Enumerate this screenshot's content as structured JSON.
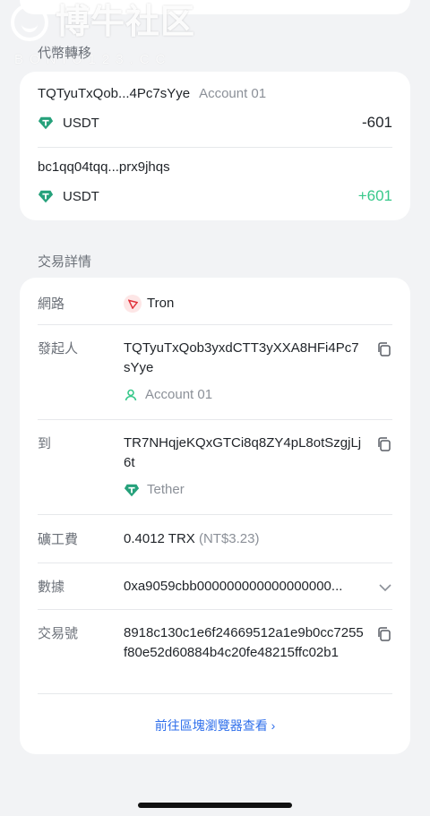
{
  "watermark": {
    "logo_text": "博牛社区",
    "sub_text": "BONIU123.CC"
  },
  "transfer_section": {
    "title": "代幣轉移"
  },
  "transfer": {
    "from_address": "TQTyuTxQob...4Pc7sYye",
    "from_account": "Account 01",
    "from_token": "USDT",
    "from_amount": "-601",
    "to_address": "bc1qq04tqq...prx9jhqs",
    "to_token": "USDT",
    "to_amount": "+601"
  },
  "details_section": {
    "title": "交易詳情"
  },
  "details": {
    "network": {
      "label": "網路",
      "value": "Tron"
    },
    "sender": {
      "label": "發起人",
      "address": "TQTyuTxQob3yxdCTT3yXXA8HFi4Pc7sYye",
      "account": "Account 01"
    },
    "to": {
      "label": "到",
      "address": "TR7NHqjeKQxGTCi8q8ZY4pL8otSzgjLj6t",
      "name": "Tether"
    },
    "fee": {
      "label": "礦工費",
      "value": "0.4012 TRX",
      "fiat": "(NT$3.23)"
    },
    "data": {
      "label": "數據",
      "value": "0xa9059cbb000000000000000000..."
    },
    "tx_hash": {
      "label": "交易號",
      "value": "8918c130c1e6f24669512a1e9b0cc7255f80e52d60884b4c20fe48215ffc02b1"
    }
  },
  "explorer_link": "前往區塊瀏覽器查看 ›",
  "colors": {
    "accent": "#2f6feb",
    "positive": "#37c88a",
    "tether": "#26a17b",
    "tron": "#e0313a"
  }
}
